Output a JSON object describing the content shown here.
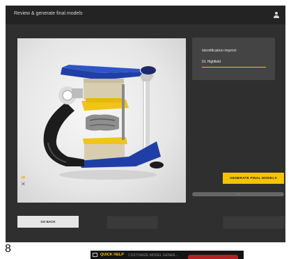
{
  "app": {
    "title": "Review & generate final models",
    "user_icon": "user-icon"
  },
  "identification": {
    "label": "Identification imprint:",
    "value": "DL Highfield"
  },
  "actions": {
    "generate_label": "GENERATE FINAL MODELS",
    "go_back_label": "GO BACK",
    "send_label": "",
    "next_label": ""
  },
  "progress": {
    "fraction": 0.0,
    "label": "---"
  },
  "view_controls": {
    "top_symbol": "≡",
    "bottom_symbol": "✕"
  },
  "page_number": "8",
  "status_bar": {
    "quick_help": "QUICK HELP",
    "info_text": "CUSTOMIZE MODEL GENER..."
  },
  "colors": {
    "accent": "#f5c400",
    "articulator_dark": "#1c1c1c",
    "articulator_blue": "#1f3fa6",
    "model_yellow": "#f0c419",
    "model_stone": "#d9cdb0",
    "status_red": "#b22222"
  }
}
